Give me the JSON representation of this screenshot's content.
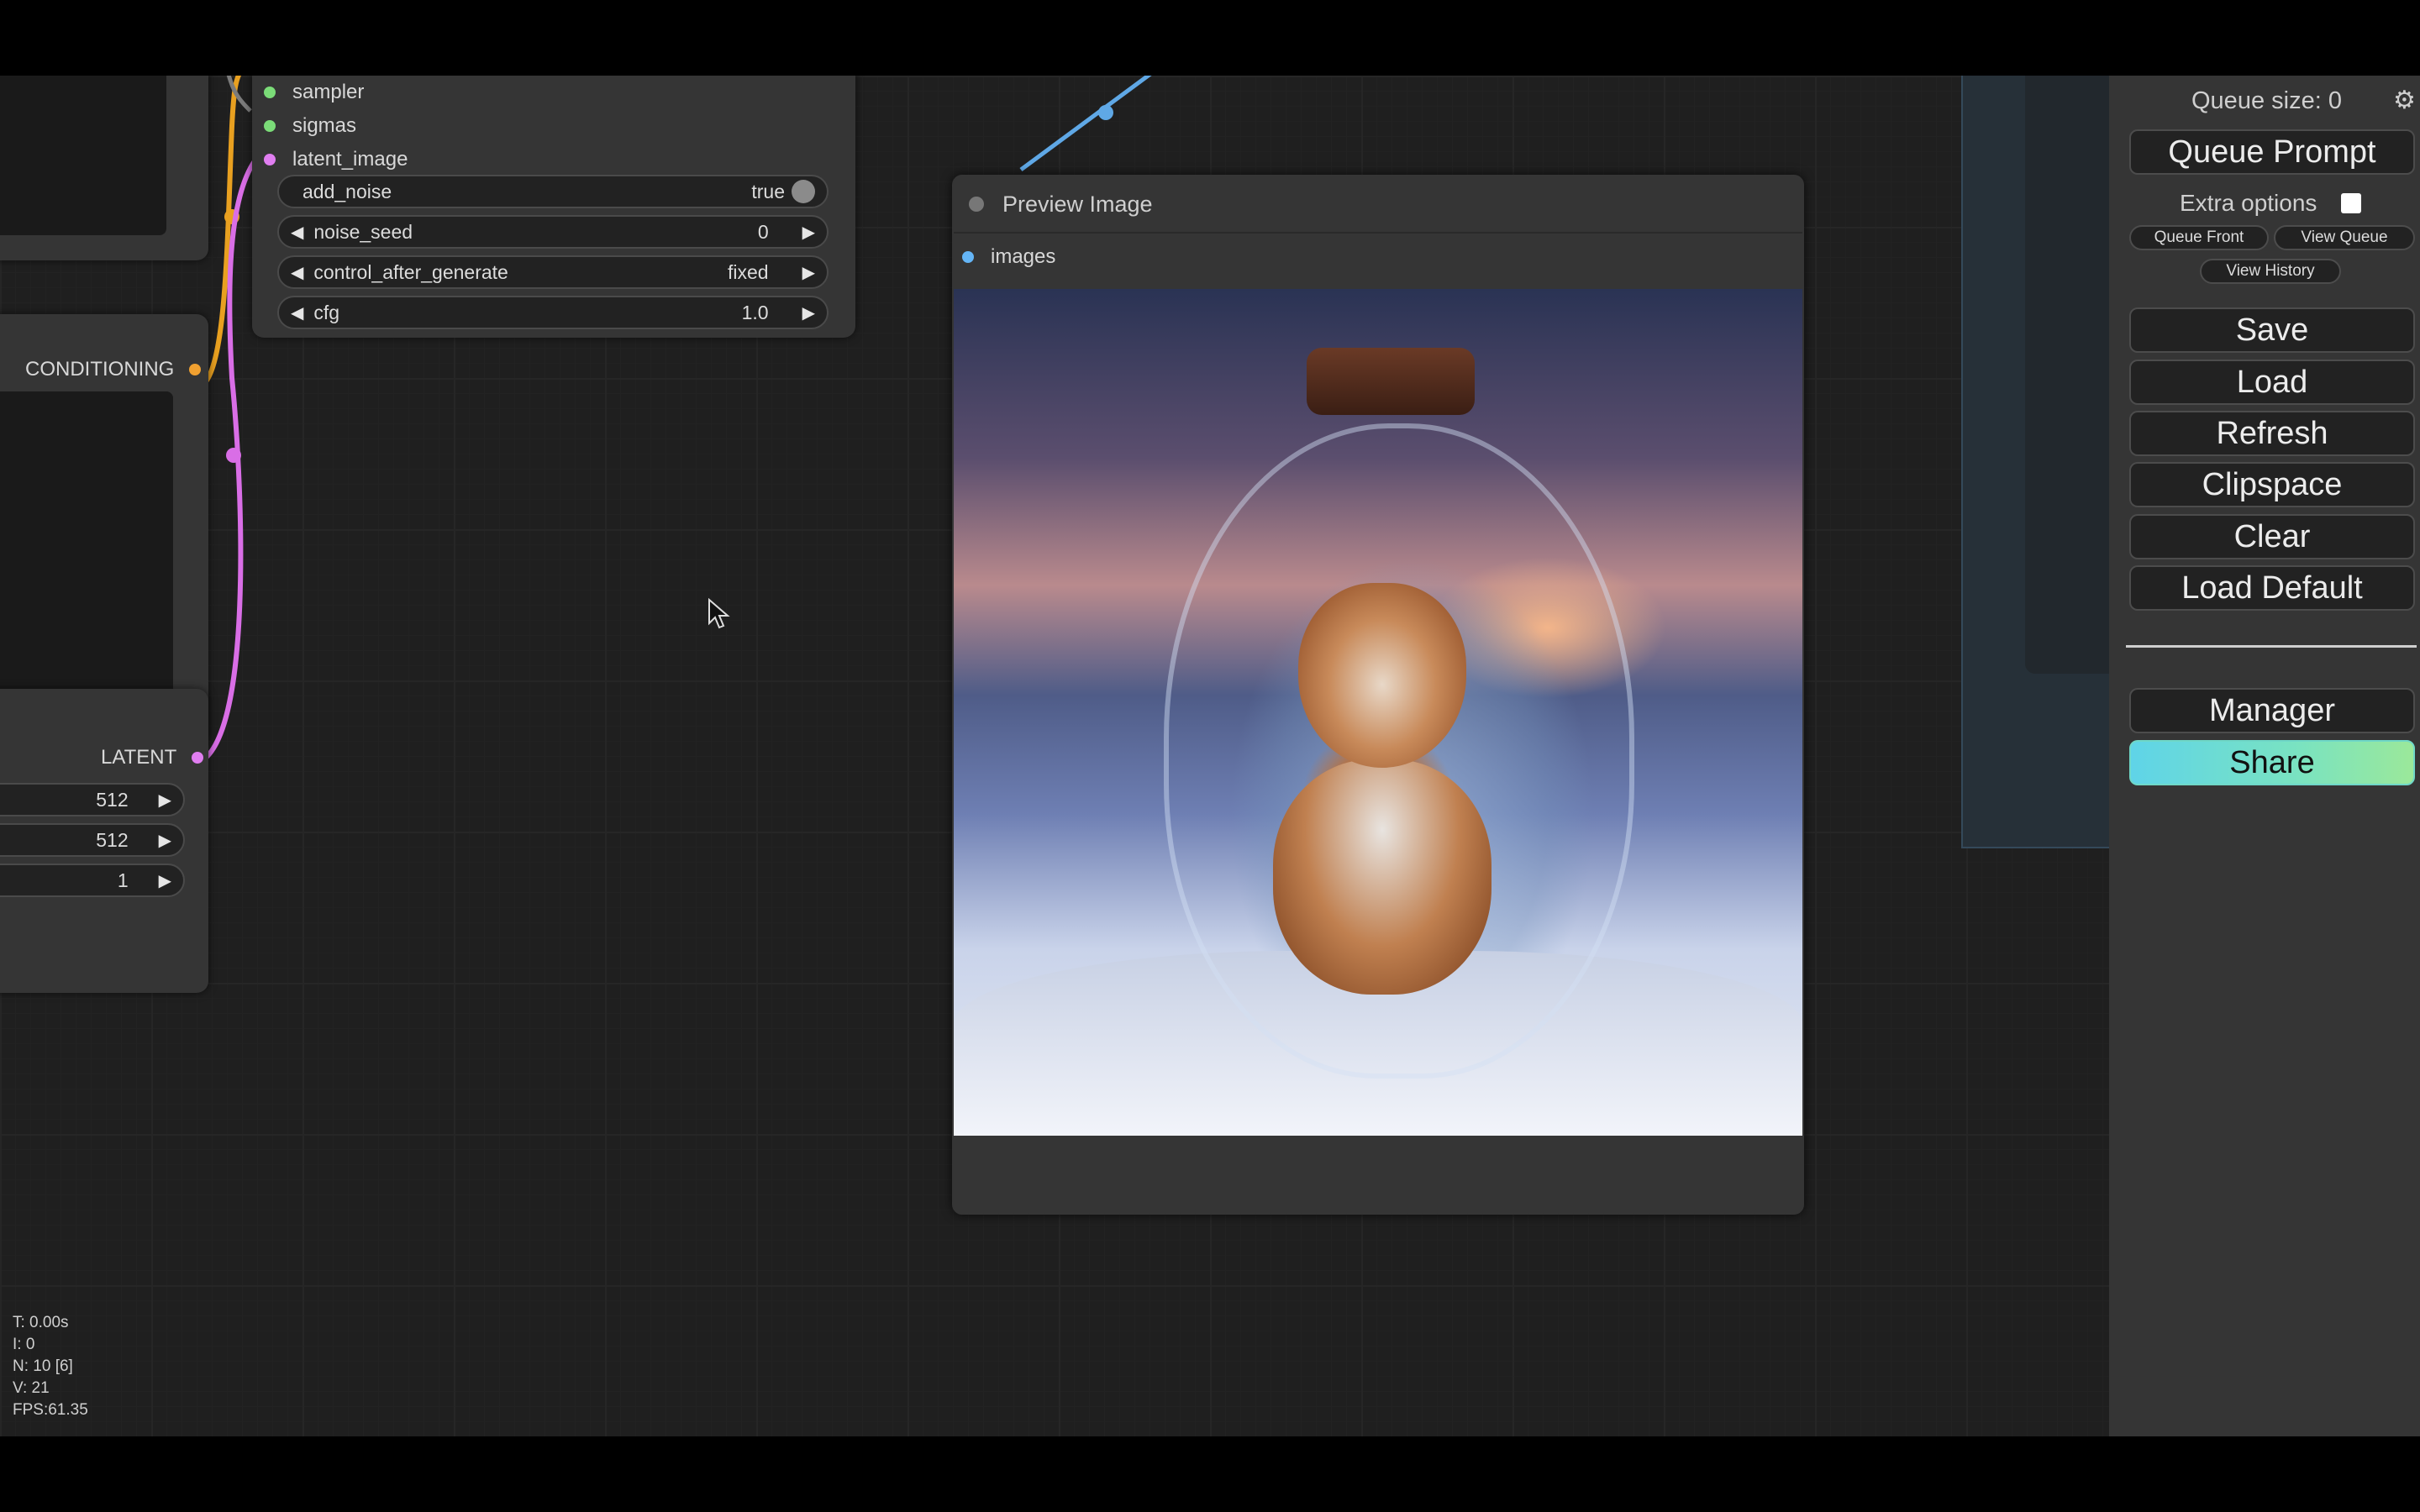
{
  "sampler_node": {
    "inputs": [
      "sampler",
      "sigmas",
      "latent_image"
    ],
    "widgets": [
      {
        "label": "add_noise",
        "value": "true"
      },
      {
        "label": "noise_seed",
        "value": "0"
      },
      {
        "label": "control_after_generate",
        "value": "fixed"
      },
      {
        "label": "cfg",
        "value": "1.0"
      }
    ]
  },
  "left_nodes": {
    "conditioning_label": "CONDITIONING",
    "latent_label": "LATENT",
    "latent_values": [
      "512",
      "512",
      "1"
    ]
  },
  "preview_node": {
    "title": "Preview Image",
    "input_label": "images"
  },
  "stats": {
    "t": "T: 0.00s",
    "i": "I: 0",
    "n": "N: 10 [6]",
    "v": "V: 21",
    "fps": "FPS:61.35"
  },
  "menu": {
    "queue_size": "Queue size: 0",
    "queue_prompt": "Queue Prompt",
    "extra_options": "Extra options",
    "queue_front": "Queue Front",
    "view_queue": "View Queue",
    "view_history": "View History",
    "save": "Save",
    "load": "Load",
    "refresh": "Refresh",
    "clipspace": "Clipspace",
    "clear": "Clear",
    "load_default": "Load Default",
    "manager": "Manager",
    "share": "Share"
  },
  "colors": {
    "sampler_dot": "#7bdc78",
    "latent_dot": "#e07ef0",
    "conditioning_dot": "#f0a030",
    "image_dot": "#64b5f6",
    "link_pink": "#d96ee6",
    "link_orange": "#e8a020",
    "link_blue": "#5fa8e6"
  }
}
